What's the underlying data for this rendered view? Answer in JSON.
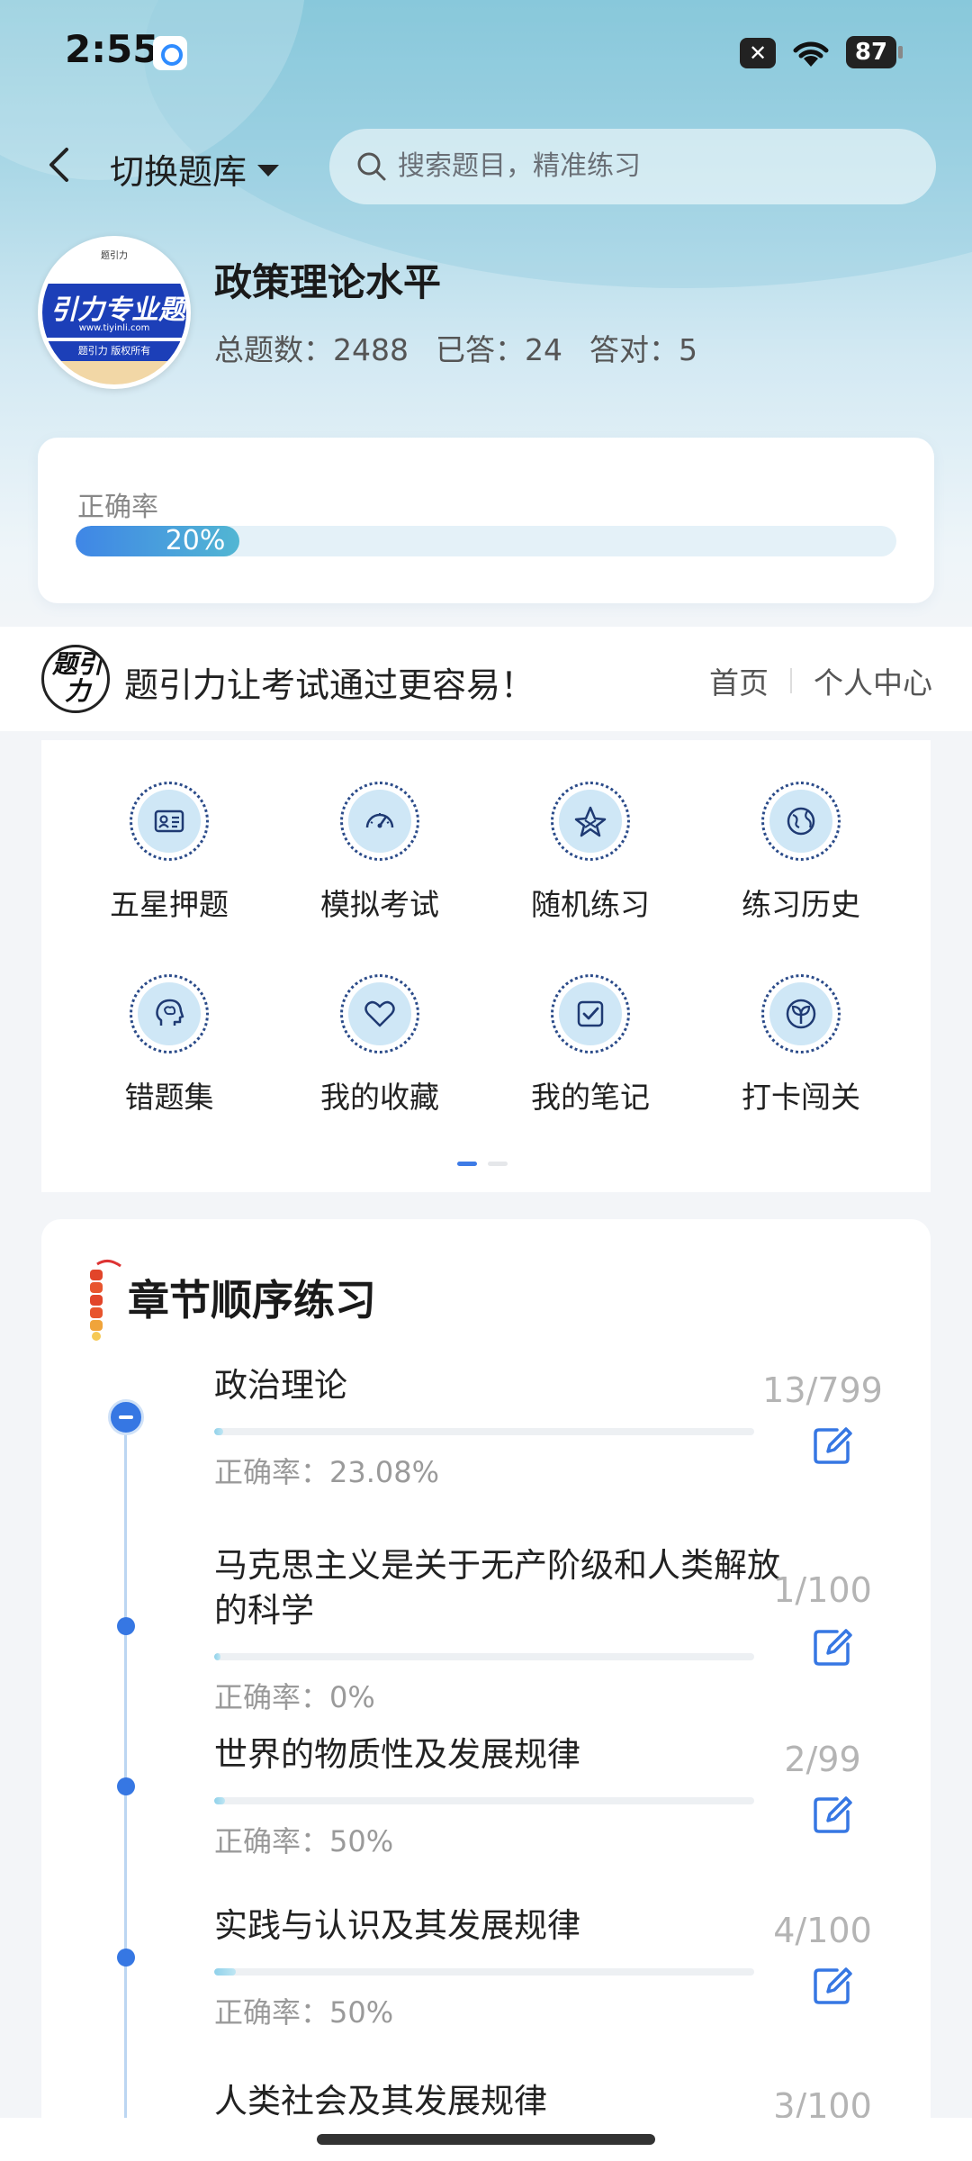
{
  "status_bar": {
    "time": "2:55",
    "battery": "87",
    "sim_icon": "x-icon"
  },
  "header": {
    "back_icon": "chevron-left-icon",
    "switch_label": "切换题库",
    "search_placeholder": "搜索题目，精准练习"
  },
  "bank": {
    "title": "政策理论水平",
    "logo_text": "引力专业题",
    "logo_url": "www.tiyinli.com",
    "logo_footer": "题引力 版权所有",
    "logo_top": "题引力",
    "stats": [
      {
        "label": "总题数：",
        "value": "2488"
      },
      {
        "label": "已答：",
        "value": "24"
      },
      {
        "label": "答对：",
        "value": "5"
      }
    ]
  },
  "accuracy": {
    "label": "正确率",
    "percent_text": "20%",
    "fraction": 0.2
  },
  "promo": {
    "logo_text": "题引力",
    "slogan": "题引力让考试通过更容易！",
    "links": [
      "首页",
      "个人中心"
    ]
  },
  "functions": [
    {
      "label": "五星押题",
      "icon": "id-card-icon"
    },
    {
      "label": "模拟考试",
      "icon": "speedometer-icon"
    },
    {
      "label": "随机练习",
      "icon": "random-star-icon"
    },
    {
      "label": "练习历史",
      "icon": "globe-icon"
    },
    {
      "label": "错题集",
      "icon": "head-brain-icon"
    },
    {
      "label": "我的收藏",
      "icon": "heart-icon"
    },
    {
      "label": "我的笔记",
      "icon": "checked-note-icon"
    },
    {
      "label": "打卡闯关",
      "icon": "sprout-icon"
    }
  ],
  "pager": {
    "pages": 2,
    "active": 0
  },
  "chapters": {
    "title": "章节顺序练习",
    "items": [
      {
        "name": "政治理论",
        "accuracy": "正确率：23.08%",
        "count": "13/799",
        "progress": 0.016,
        "open": true
      },
      {
        "name": "马克思主义是关于无产阶级和人类解放的科学",
        "accuracy": "正确率：0%",
        "count": "1/100",
        "progress": 0.01,
        "open": false
      },
      {
        "name": "世界的物质性及发展规律",
        "accuracy": "正确率：50%",
        "count": "2/99",
        "progress": 0.02,
        "open": false
      },
      {
        "name": "实践与认识及其发展规律",
        "accuracy": "正确率：50%",
        "count": "4/100",
        "progress": 0.04,
        "open": false
      },
      {
        "name": "人类社会及其发展规律",
        "accuracy": "",
        "count": "3/100",
        "progress": 0.03,
        "open": false
      }
    ],
    "edit_icon": "edit-icon"
  },
  "colors": {
    "accent": "#3677e3",
    "progress_start": "#3f86e6",
    "progress_end": "#52b6d3"
  }
}
